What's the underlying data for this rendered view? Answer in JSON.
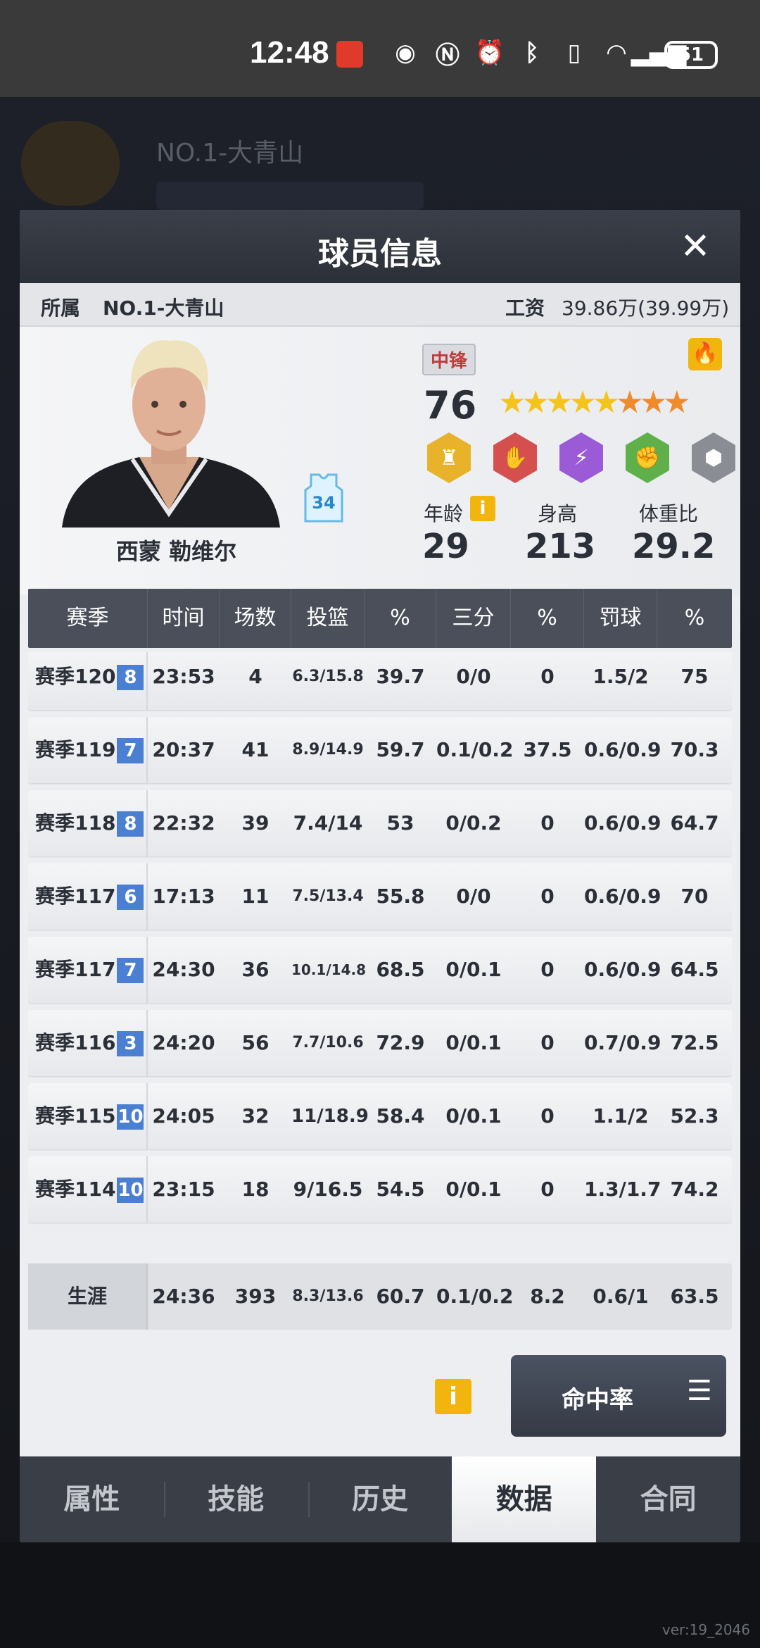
{
  "status_bar": {
    "time": "12:48",
    "battery": "51",
    "icons": [
      "eye-icon",
      "nfc-icon",
      "alarm-icon",
      "bluetooth-icon",
      "vibrate-icon",
      "wifi-icon",
      "5g-signal-icon"
    ]
  },
  "background": {
    "team_name": "NO.1-大青山"
  },
  "modal": {
    "title": "球员信息",
    "affiliation_label": "所属",
    "affiliation_value": "NO.1-大青山",
    "salary_label": "工资",
    "salary_value": "39.86万(39.99万)"
  },
  "player": {
    "name": "西蒙 勒维尔",
    "jersey_number": "34",
    "position": "中锋",
    "rating": "76",
    "stars": {
      "gold": 5,
      "orange": 3
    },
    "age_label": "年龄",
    "age": "29",
    "height_label": "身高",
    "height": "213",
    "weight_ratio_label": "体重比",
    "weight_ratio": "29.2"
  },
  "table": {
    "headers": [
      "赛季",
      "时间",
      "场数",
      "投篮",
      "%",
      "三分",
      "%",
      "罚球",
      "%"
    ],
    "rows": [
      {
        "season": "赛季120",
        "num": "8",
        "time": "23:53",
        "games": "4",
        "fg": "6.3/15.8",
        "fg_pct": "39.7",
        "three": "0/0",
        "three_pct": "0",
        "ft": "1.5/2",
        "ft_pct": "75"
      },
      {
        "season": "赛季119",
        "num": "7",
        "time": "20:37",
        "games": "41",
        "fg": "8.9/14.9",
        "fg_pct": "59.7",
        "three": "0.1/0.2",
        "three_pct": "37.5",
        "ft": "0.6/0.9",
        "ft_pct": "70.3"
      },
      {
        "season": "赛季118",
        "num": "8",
        "time": "22:32",
        "games": "39",
        "fg": "7.4/14",
        "fg_pct": "53",
        "three": "0/0.2",
        "three_pct": "0",
        "ft": "0.6/0.9",
        "ft_pct": "64.7"
      },
      {
        "season": "赛季117",
        "num": "6",
        "time": "17:13",
        "games": "11",
        "fg": "7.5/13.4",
        "fg_pct": "55.8",
        "three": "0/0",
        "three_pct": "0",
        "ft": "0.6/0.9",
        "ft_pct": "70"
      },
      {
        "season": "赛季117",
        "num": "7",
        "time": "24:30",
        "games": "36",
        "fg": "10.1/14.8",
        "fg_pct": "68.5",
        "three": "0/0.1",
        "three_pct": "0",
        "ft": "0.6/0.9",
        "ft_pct": "64.5"
      },
      {
        "season": "赛季116",
        "num": "3",
        "time": "24:20",
        "games": "56",
        "fg": "7.7/10.6",
        "fg_pct": "72.9",
        "three": "0/0.1",
        "three_pct": "0",
        "ft": "0.7/0.9",
        "ft_pct": "72.5"
      },
      {
        "season": "赛季115",
        "num": "10",
        "time": "24:05",
        "games": "32",
        "fg": "11/18.9",
        "fg_pct": "58.4",
        "three": "0/0.1",
        "three_pct": "0",
        "ft": "1.1/2",
        "ft_pct": "52.3"
      },
      {
        "season": "赛季114",
        "num": "10",
        "time": "23:15",
        "games": "18",
        "fg": "9/16.5",
        "fg_pct": "54.5",
        "three": "0/0.1",
        "three_pct": "0",
        "ft": "1.3/1.7",
        "ft_pct": "74.2"
      }
    ],
    "career": {
      "label": "生涯",
      "time": "24:36",
      "games": "393",
      "fg": "8.3/13.6",
      "fg_pct": "60.7",
      "three": "0.1/0.2",
      "three_pct": "8.2",
      "ft": "0.6/1",
      "ft_pct": "63.5"
    }
  },
  "controls": {
    "hit_rate_label": "命中率"
  },
  "tabs": [
    "属性",
    "技能",
    "历史",
    "数据",
    "合同"
  ],
  "active_tab": "数据",
  "version": "ver:19_2046"
}
